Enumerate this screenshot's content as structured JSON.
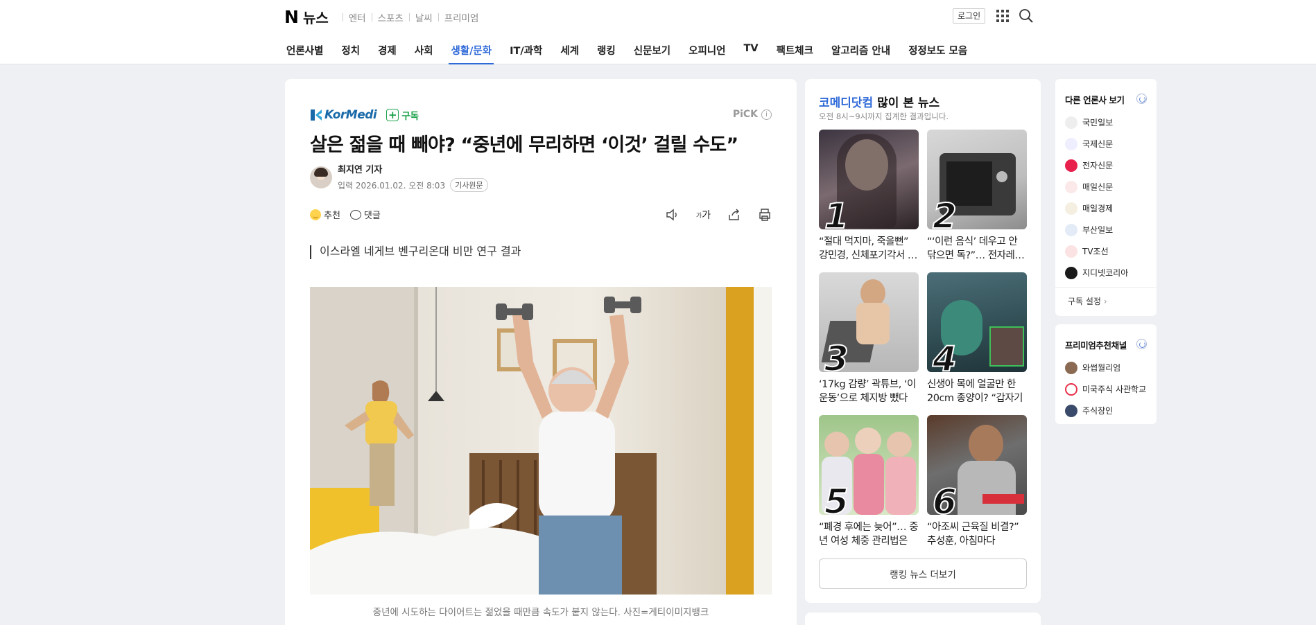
{
  "header": {
    "logo": "N",
    "service_name": "뉴스",
    "services": [
      "엔터",
      "스포츠",
      "날씨",
      "프리미엄"
    ],
    "login": "로그인"
  },
  "nav": {
    "items": [
      "언론사별",
      "정치",
      "경제",
      "사회",
      "생활/문화",
      "IT/과학",
      "세계",
      "랭킹",
      "신문보기",
      "오피니언",
      "TV",
      "팩트체크",
      "알고리즘 안내",
      "정정보도 모음"
    ],
    "active": "생활/문화"
  },
  "article": {
    "press": "KorMedi",
    "subscribe": "구독",
    "pick": "PiCK",
    "headline": "살은 젊을 때 빼야? “중년에 무리하면 ‘이것’ 걸릴 수도”",
    "reporter": "최지연 기자",
    "date": "입력 2026.01.02. 오전 8:03",
    "original": "기사원문",
    "like": "추천",
    "comment": "댓글",
    "font_tool": "가",
    "summary": "이스라엘 네게브 벤구리온대 비만 연구 결과",
    "caption": "중년에 시도하는 다이어트는 젊었을 때만큼 속도가 붙지 않는다. 사진=게티이미지뱅크"
  },
  "most_viewed": {
    "press": "코메디닷컴",
    "title_suffix": " 많이 본 뉴스",
    "subtitle": "오전 8시~9시까지 집계한 결과입니다.",
    "items": [
      {
        "rank": "1",
        "text": "“절대 먹지마, 죽을뻔” 강민경, 신체포기각서 썼다"
      },
      {
        "rank": "2",
        "text": "“‘이런 음식’ 데우고 안 닦으면 독?”… 전자레인지"
      },
      {
        "rank": "3",
        "text": "‘17kg 감량’ 곽튜브, ‘이 운동’으로 체지방 뺐다"
      },
      {
        "rank": "4",
        "text": "신생아 목에 얼굴만 한 20cm 종양이? “갑자기"
      },
      {
        "rank": "5",
        "text": "“폐경 후에는 늦어”… 중년 여성 체중 관리법은"
      },
      {
        "rank": "6",
        "text": "“아조씨 근육질 비결?” 추성훈, 아침마다"
      }
    ],
    "more": "랭킹 뉴스 더보기"
  },
  "sidebar": {
    "other_press_title": "다른 언론사 보기",
    "press_list": [
      {
        "name": "국민일보",
        "color": "#e8e8e8"
      },
      {
        "name": "국제신문",
        "color": "#e8e8e8"
      },
      {
        "name": "전자신문",
        "color": "#e8204c"
      },
      {
        "name": "매일신문",
        "color": "#f0f0f0"
      },
      {
        "name": "매일경제",
        "color": "#f0f0f0"
      },
      {
        "name": "부산일보",
        "color": "#f0f0f0"
      },
      {
        "name": "TV조선",
        "color": "#f0f0f0"
      },
      {
        "name": "지디넷코리아",
        "color": "#1a1a1a"
      }
    ],
    "subscription_settings": "구독 설정",
    "premium_title": "프리미엄추천채널",
    "premium_list": [
      {
        "name": "와썹월리엄",
        "color": "#8a6a52"
      },
      {
        "name": "미국주식 사관학교",
        "color": "#e8304a"
      },
      {
        "name": "주식장인",
        "color": "#3a4a6a"
      }
    ]
  }
}
